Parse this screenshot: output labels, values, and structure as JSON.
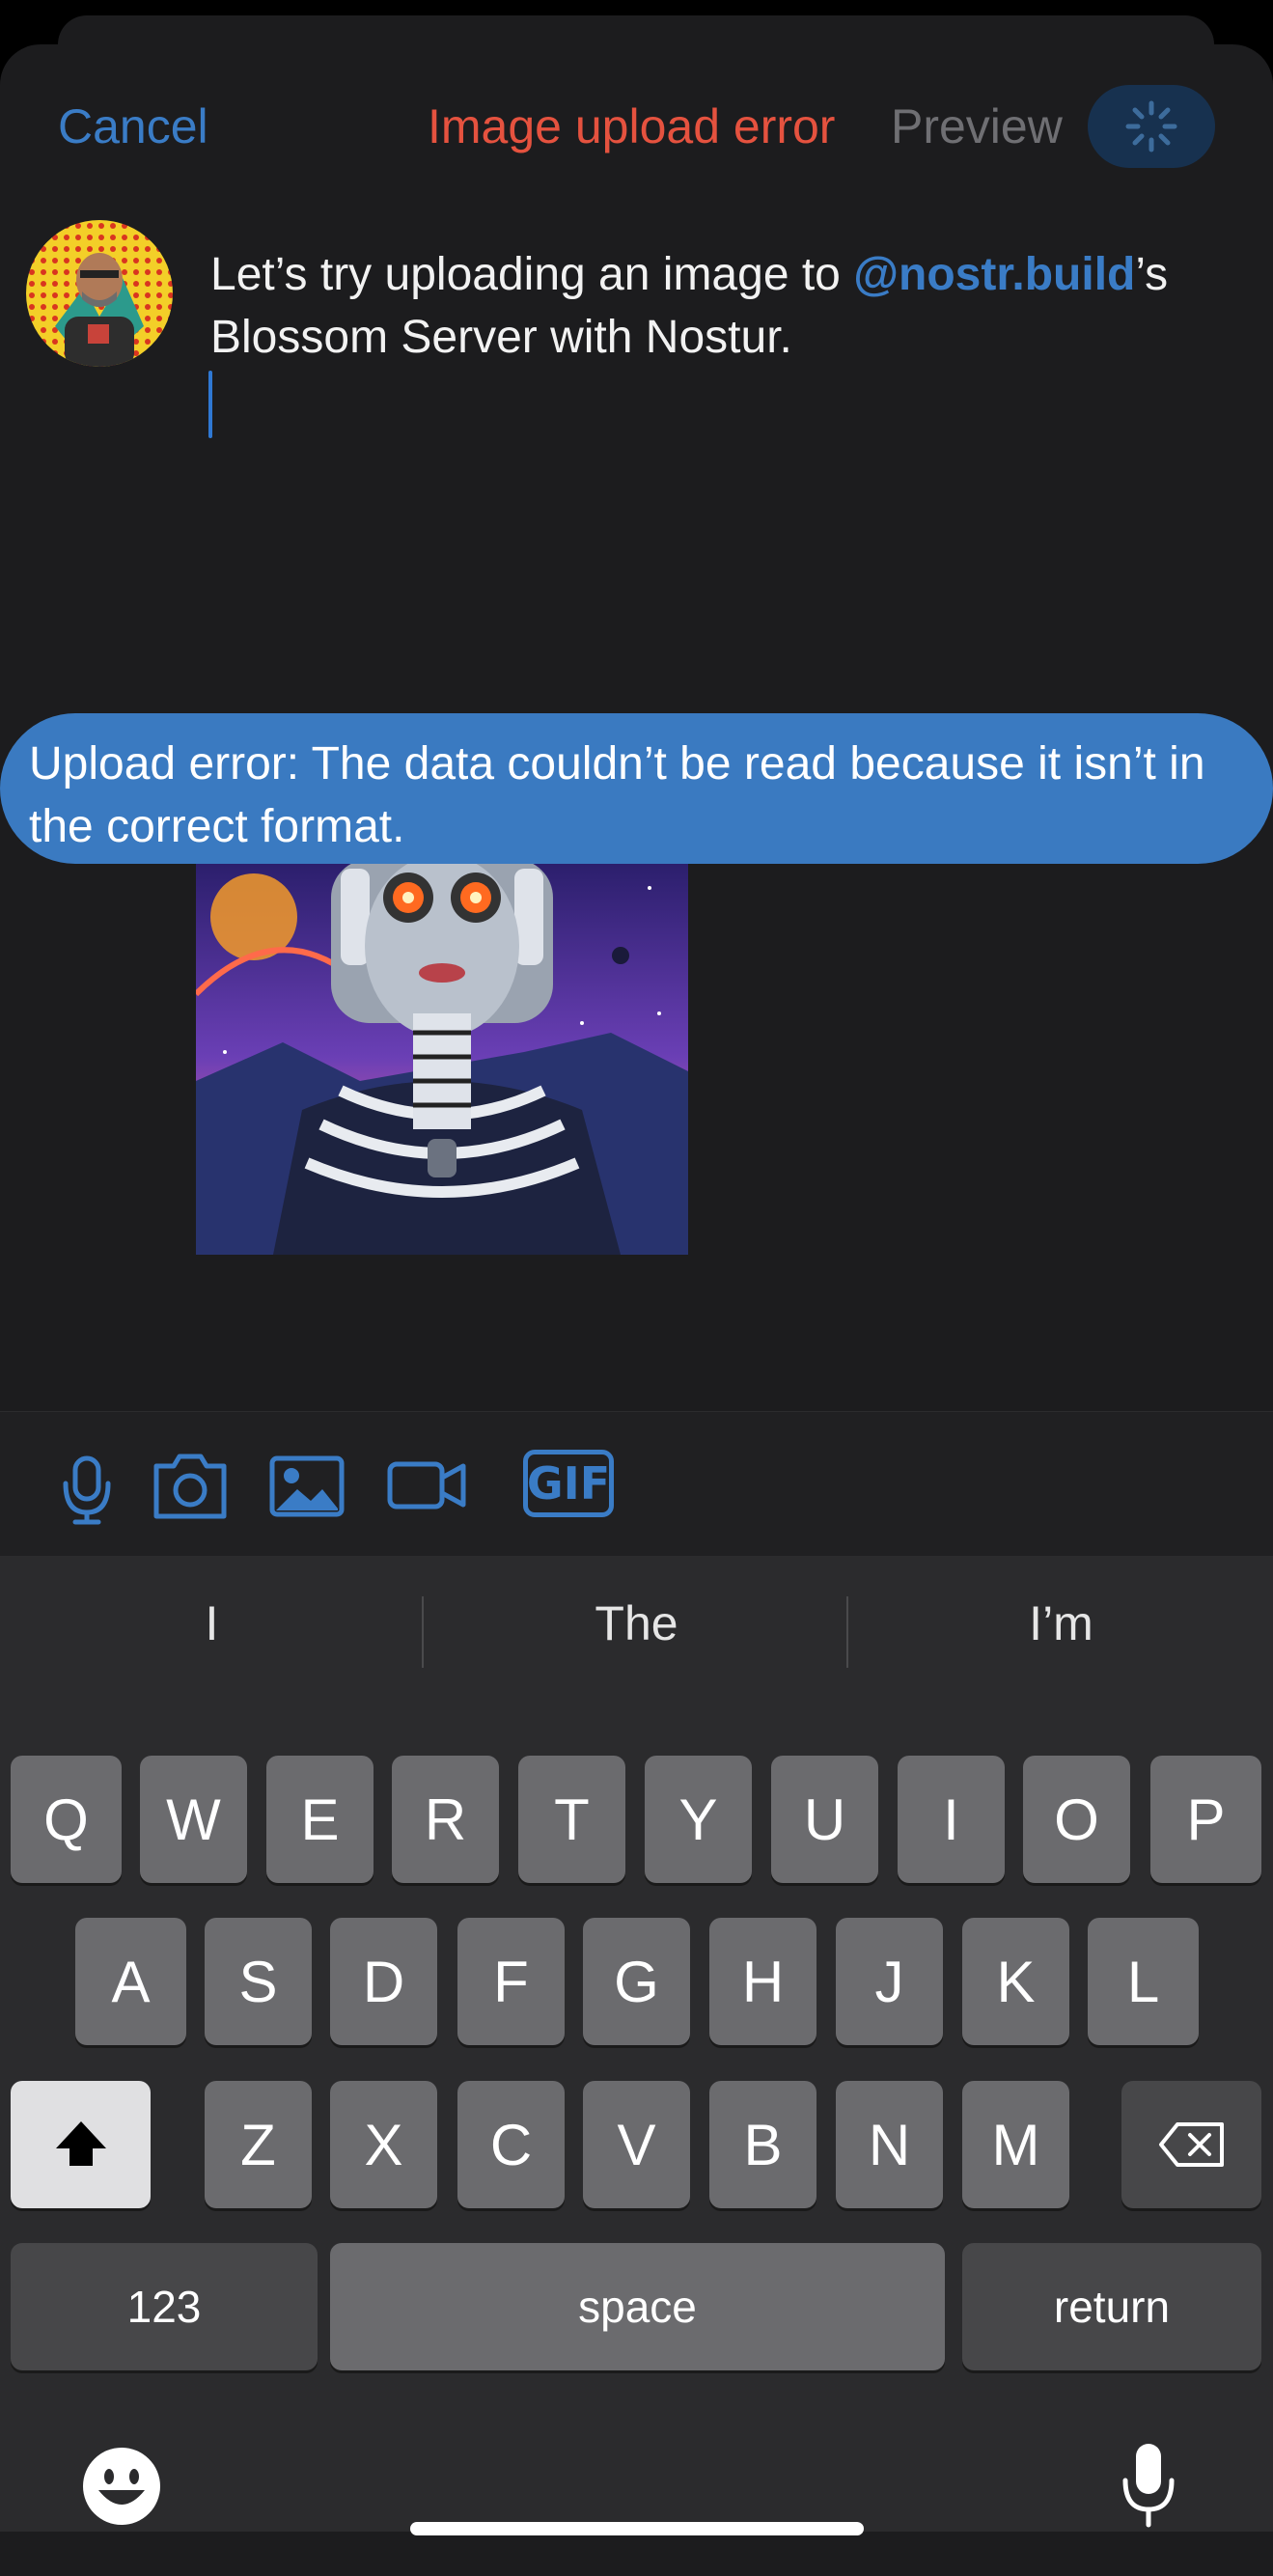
{
  "header": {
    "cancel": "Cancel",
    "error_title": "Image upload error",
    "preview": "Preview"
  },
  "composer": {
    "text_before": "Let’s try uploading an image to ",
    "mention": "@nostr.build",
    "text_after": "’s Blossom Server with Nostur."
  },
  "toast": {
    "message": "Upload error: The data couldn’t be read because it isn’t in the correct format."
  },
  "toolbar": {
    "icons": [
      "microphone-icon",
      "camera-icon",
      "photo-icon",
      "video-icon",
      "gif-icon"
    ],
    "gif_label": "GIF"
  },
  "keyboard": {
    "suggestions": [
      "I",
      "The",
      "I’m"
    ],
    "row1": [
      "Q",
      "W",
      "E",
      "R",
      "T",
      "Y",
      "U",
      "I",
      "O",
      "P"
    ],
    "row2": [
      "A",
      "S",
      "D",
      "F",
      "G",
      "H",
      "J",
      "K",
      "L"
    ],
    "row3": [
      "Z",
      "X",
      "C",
      "V",
      "B",
      "N",
      "M"
    ],
    "numbers": "123",
    "space": "space",
    "return": "return"
  },
  "colors": {
    "accent": "#3a7cc6",
    "error": "#e5523f",
    "toast": "#3a7ac1"
  }
}
